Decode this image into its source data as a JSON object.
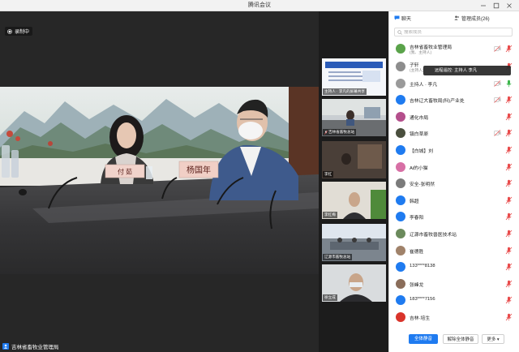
{
  "window": {
    "title": "腾讯会议"
  },
  "recording": {
    "label": "录制中"
  },
  "main_video": {
    "speaker_label": "吉林省畜牧业管理局",
    "placards": [
      "付 茹",
      "杨国年"
    ]
  },
  "thumbnails": [
    {
      "label": "主持人 · 李凡的屏幕共享"
    },
    {
      "label": "吉林省畜牧总站"
    },
    {
      "label": "李红"
    },
    {
      "label": "李红梅"
    },
    {
      "label": "辽源市畜牧总站"
    },
    {
      "label": "徐立成"
    }
  ],
  "sidebar": {
    "tabs": {
      "chat": "聊天",
      "members": "管理成员(26)"
    },
    "search_placeholder": "搜索成员",
    "tooltip": "远程遥控: 主持人 李凡",
    "members": [
      {
        "name": "吉林省畜牧业管理局",
        "sub": "(我、主持人)",
        "avatar_color": "#5aa34a",
        "mic": "muted",
        "camera": "off"
      },
      {
        "name": "子轩",
        "sub": "(主持人)",
        "avatar_color": "#8d8d8d",
        "mic": "muted",
        "camera": "none"
      },
      {
        "name": "主持人 · 李凡",
        "sub": "",
        "avatar_color": "#9a9a9a",
        "mic": "on",
        "camera": "off"
      },
      {
        "name": "吉林辽大畜牧局(科)产业处",
        "sub": "",
        "avatar_color": "#1f7bf0",
        "mic": "muted",
        "camera": "off"
      },
      {
        "name": "通化市局",
        "sub": "",
        "avatar_color": "#b44f8c",
        "mic": "muted",
        "camera": "none"
      },
      {
        "name": "镇白草原",
        "sub": "",
        "avatar_color": "#4a4f3e",
        "mic": "muted",
        "camera": "off"
      },
      {
        "name": "【白城】刘",
        "sub": "",
        "avatar_color": "#1f7bf0",
        "mic": "muted",
        "camera": "none"
      },
      {
        "name": "Ai的小猫",
        "sub": "",
        "avatar_color": "#d76fa5",
        "mic": "muted",
        "camera": "none"
      },
      {
        "name": "安全-张明然",
        "sub": "",
        "avatar_color": "#7b7b7b",
        "mic": "muted",
        "camera": "none"
      },
      {
        "name": "韩超",
        "sub": "",
        "avatar_color": "#1f7bf0",
        "mic": "muted",
        "camera": "none"
      },
      {
        "name": "李春阳",
        "sub": "",
        "avatar_color": "#1f7bf0",
        "mic": "muted",
        "camera": "none"
      },
      {
        "name": "辽源市畜牧兽医技术站",
        "sub": "",
        "avatar_color": "#6b8a5c",
        "mic": "muted",
        "camera": "none"
      },
      {
        "name": "崔德胜",
        "sub": "",
        "avatar_color": "#a0826a",
        "mic": "muted",
        "camera": "none"
      },
      {
        "name": "133****8138",
        "sub": "",
        "avatar_color": "#1f7bf0",
        "mic": "muted",
        "camera": "none"
      },
      {
        "name": "张峰龙",
        "sub": "",
        "avatar_color": "#8a6d5a",
        "mic": "muted",
        "camera": "none"
      },
      {
        "name": "183****7156",
        "sub": "",
        "avatar_color": "#1f7bf0",
        "mic": "muted",
        "camera": "none"
      },
      {
        "name": "吉林·培生",
        "sub": "",
        "avatar_color": "#d9342b",
        "mic": "muted",
        "camera": "none"
      }
    ],
    "buttons": {
      "mute_all": "全体静音",
      "unmute_all": "解除全体静音",
      "more": "更多 ▾"
    }
  },
  "colors": {
    "accent": "#1f7bf0",
    "muted": "#e84a4a",
    "mic_on": "#3bb54a",
    "video_bg": "#272727"
  },
  "icons": [
    "record-icon",
    "person-icon",
    "mic-icon",
    "mic-muted-icon",
    "camera-off-icon",
    "chat-icon",
    "members-icon",
    "search-icon",
    "minimize-icon",
    "maximize-icon",
    "close-icon"
  ]
}
